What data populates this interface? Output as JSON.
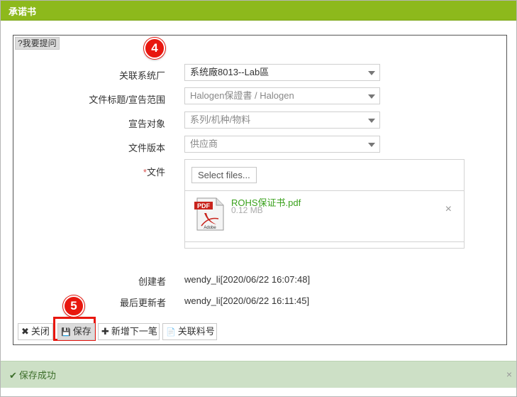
{
  "window": {
    "title": "承诺书"
  },
  "help_button": {
    "label": "?我要提问"
  },
  "markers": {
    "four": "4",
    "five": "5"
  },
  "form": {
    "related_system_label": "关联系统厂",
    "related_system_value": "系统廠8013--Lab區",
    "doc_title_label": "文件标题/宣告范围",
    "doc_title_value": "Halogen保證書 / Halogen",
    "declare_object_label": "宣告对象",
    "declare_object_value": "系列/机种/物料",
    "doc_version_label": "文件版本",
    "doc_version_value": "供应商",
    "file_label_required": "*",
    "file_label": "文件",
    "select_files": "Select files...",
    "file": {
      "name": "ROHS保证书.pdf",
      "size": "0.12 MB",
      "remove": "×",
      "icon_text": "PDF",
      "icon_brand": "Adobe"
    },
    "creator_label": "创建者",
    "creator_value": "wendy_li[2020/06/22 16:07:48]",
    "updater_label": "最后更新者",
    "updater_value": "wendy_li[2020/06/22 16:11:45]"
  },
  "buttons": {
    "close": {
      "icon": "✖",
      "label": "关闭"
    },
    "save": {
      "icon": "💾",
      "label": "保存"
    },
    "add_next": {
      "icon": "✚",
      "label": "新增下一笔"
    },
    "related_part": {
      "icon": "📄",
      "label": "关联料号"
    }
  },
  "notice": {
    "icon": "✔",
    "message": "保存成功",
    "close": "×"
  },
  "colors": {
    "title_bar": "#8db91c",
    "marker": "#e8170f",
    "file_link": "#3aa11c",
    "success_bg": "#cde0c6"
  }
}
